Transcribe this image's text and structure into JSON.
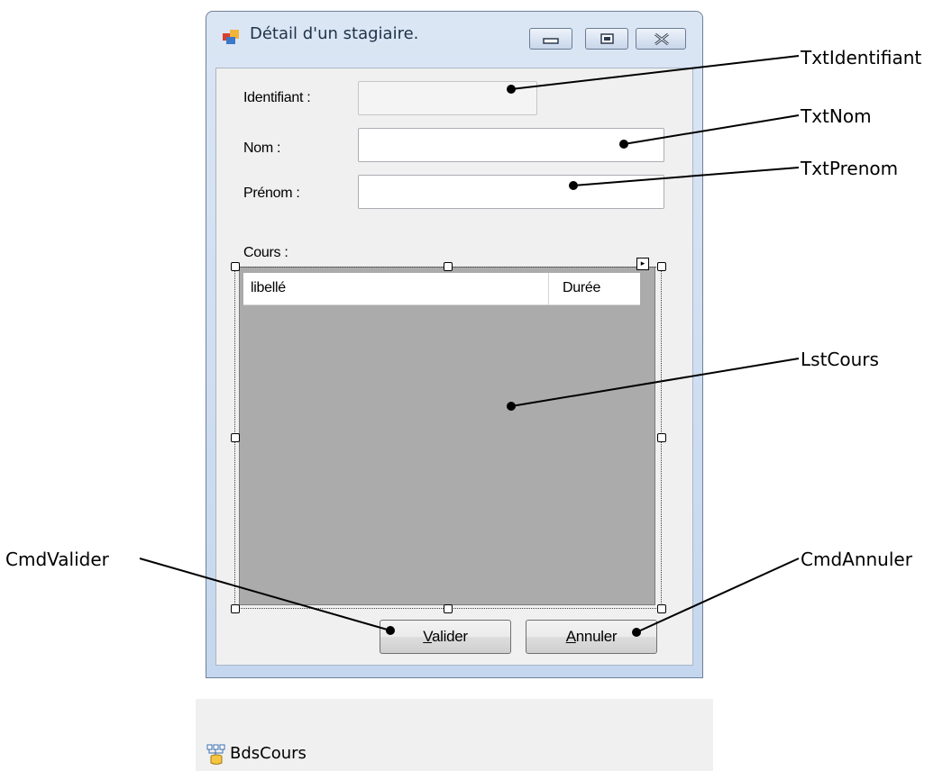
{
  "window": {
    "title": "Détail d'un stagiaire."
  },
  "form": {
    "identifiant_label": "Identifiant :",
    "identifiant_value": "",
    "nom_label": "Nom :",
    "nom_value": "",
    "prenom_label": "Prénom :",
    "prenom_value": "",
    "cours_label": "Cours :"
  },
  "list": {
    "columns": [
      "libellé",
      "Durée"
    ]
  },
  "buttons": {
    "valider": {
      "accel": "V",
      "rest": "alider"
    },
    "annuler": {
      "accel": "A",
      "rest": "nnuler"
    }
  },
  "annotations": {
    "txt_identifiant": "TxtIdentifiant",
    "txt_nom": "TxtNom",
    "txt_prenom": "TxtPrenom",
    "lst_cours": "LstCours",
    "cmd_valider": "CmdValider",
    "cmd_annuler": "CmdAnnuler"
  },
  "tray": {
    "component": "BdsCours"
  },
  "colors": {
    "list_background": "#ababab",
    "client_background": "#f0f0f0"
  }
}
